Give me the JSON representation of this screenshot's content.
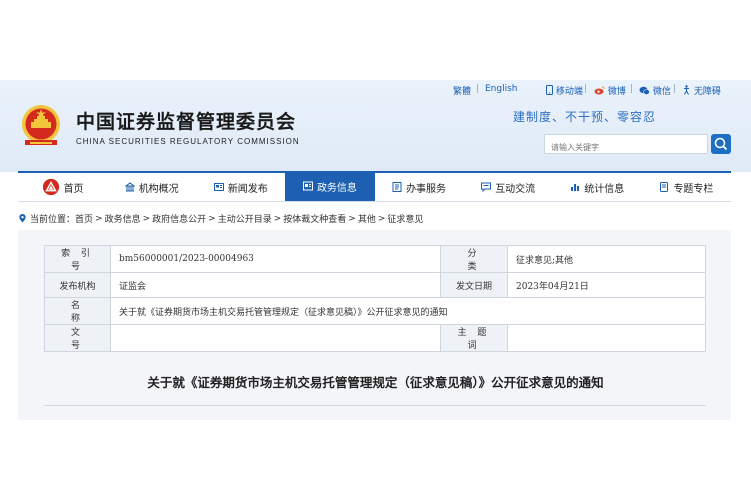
{
  "top_links": {
    "traditional": "繁體",
    "english": "English",
    "mobile": "移动端",
    "weibo": "微博",
    "wechat": "微信",
    "accessibility": "无障碍"
  },
  "header": {
    "title_cn": "中国证券监督管理委员会",
    "title_en": "CHINA SECURITIES REGULATORY COMMISSION",
    "slogan": "建制度、不干预、零容忍",
    "search_placeholder": "请输入关键字"
  },
  "nav": {
    "items": [
      {
        "label": "首页",
        "icon": "home-icon"
      },
      {
        "label": "机构概况",
        "icon": "building-icon"
      },
      {
        "label": "新闻发布",
        "icon": "news-icon"
      },
      {
        "label": "政务信息",
        "icon": "gov-info-icon",
        "active": true
      },
      {
        "label": "办事服务",
        "icon": "service-icon"
      },
      {
        "label": "互动交流",
        "icon": "chat-icon"
      },
      {
        "label": "统计信息",
        "icon": "stats-icon"
      },
      {
        "label": "专题专栏",
        "icon": "topic-icon"
      }
    ]
  },
  "breadcrumb": {
    "prefix": "当前位置：",
    "items": [
      "首页",
      "政务信息",
      "政府信息公开",
      "主动公开目录",
      "按体裁文种查看",
      "其他",
      "征求意见"
    ],
    "separator": ">"
  },
  "meta": {
    "index_label": "索 引 号",
    "index_value": "bm56000001/2023-00004963",
    "category_label": "分　　类",
    "category_value": "征求意见;其他",
    "publisher_label": "发布机构",
    "publisher_value": "证监会",
    "date_label": "发文日期",
    "date_value": "2023年04月21日",
    "name_label": "名　　称",
    "name_value": "关于就《证券期货市场主机交易托管管理规定（征求意见稿）》公开征求意见的通知",
    "docno_label": "文　　号",
    "docno_value": "",
    "keywords_label": "主 题 词",
    "keywords_value": ""
  },
  "document": {
    "title": "关于就《证券期货市场主机交易托管管理规定（征求意见稿）》公开征求意见的通知"
  },
  "colors": {
    "primary": "#1d5fb0",
    "link": "#1a5fb4",
    "slogan": "#2d6fc4",
    "emblem_red": "#d42a1e",
    "emblem_gold": "#f2c53d"
  }
}
